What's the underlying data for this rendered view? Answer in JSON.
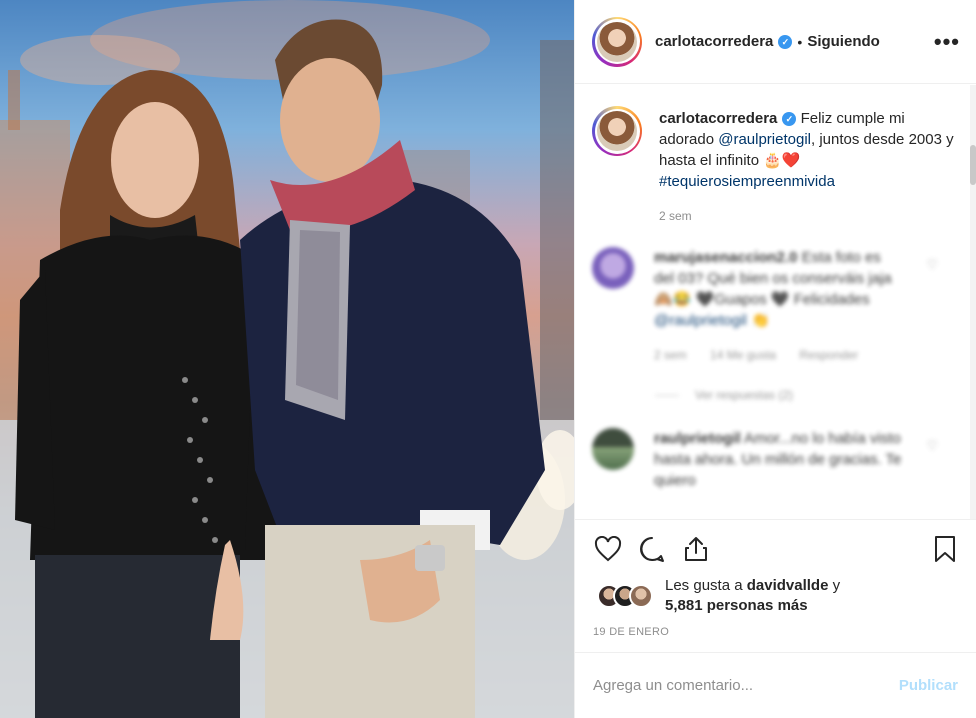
{
  "post": {
    "username": "carlotacorredera",
    "follow_status": "Siguiendo",
    "more_label": "•••"
  },
  "caption": {
    "username": "carlotacorredera",
    "text_before": "Feliz cumple mi adorado ",
    "mention": "@raulprietogil",
    "text_after": ", juntos desde 2003 y hasta el infinito 🎂❤️",
    "hashtag": "#tequierosiempreenmivida",
    "time": "2 sem"
  },
  "comments": [
    {
      "username": "marujasenaccion2.0",
      "text": "Esta foto es del 03? Qué bien os conserváis jaja 🙈😂 🖤Guapos 🖤 Felicidades ",
      "mention": "@raulprietogil",
      "emoji_end": " 👏",
      "time": "2 sem",
      "likes": "14 Me gusta",
      "reply": "Responder",
      "view_replies": "Ver respuestas (2)"
    },
    {
      "username": "raulprietogil",
      "text": "Amor...no lo había visto hasta ahora. Un millón de gracias. Te quiero"
    }
  ],
  "icons": {
    "like": "heart-icon",
    "comment": "comment-icon",
    "share": "share-icon",
    "save": "bookmark-icon"
  },
  "likes": {
    "prefix": "Les gusta a ",
    "user": "davidvalldе",
    "mid": " y",
    "count": "5,881 personas más"
  },
  "date": "19 DE ENERO",
  "comment_box": {
    "placeholder": "Agrega un comentario...",
    "publish": "Publicar"
  },
  "colors": {
    "verified": "#3897f0",
    "link": "#003569",
    "publish_disabled": "#b2dffc",
    "border": "#efefef"
  }
}
